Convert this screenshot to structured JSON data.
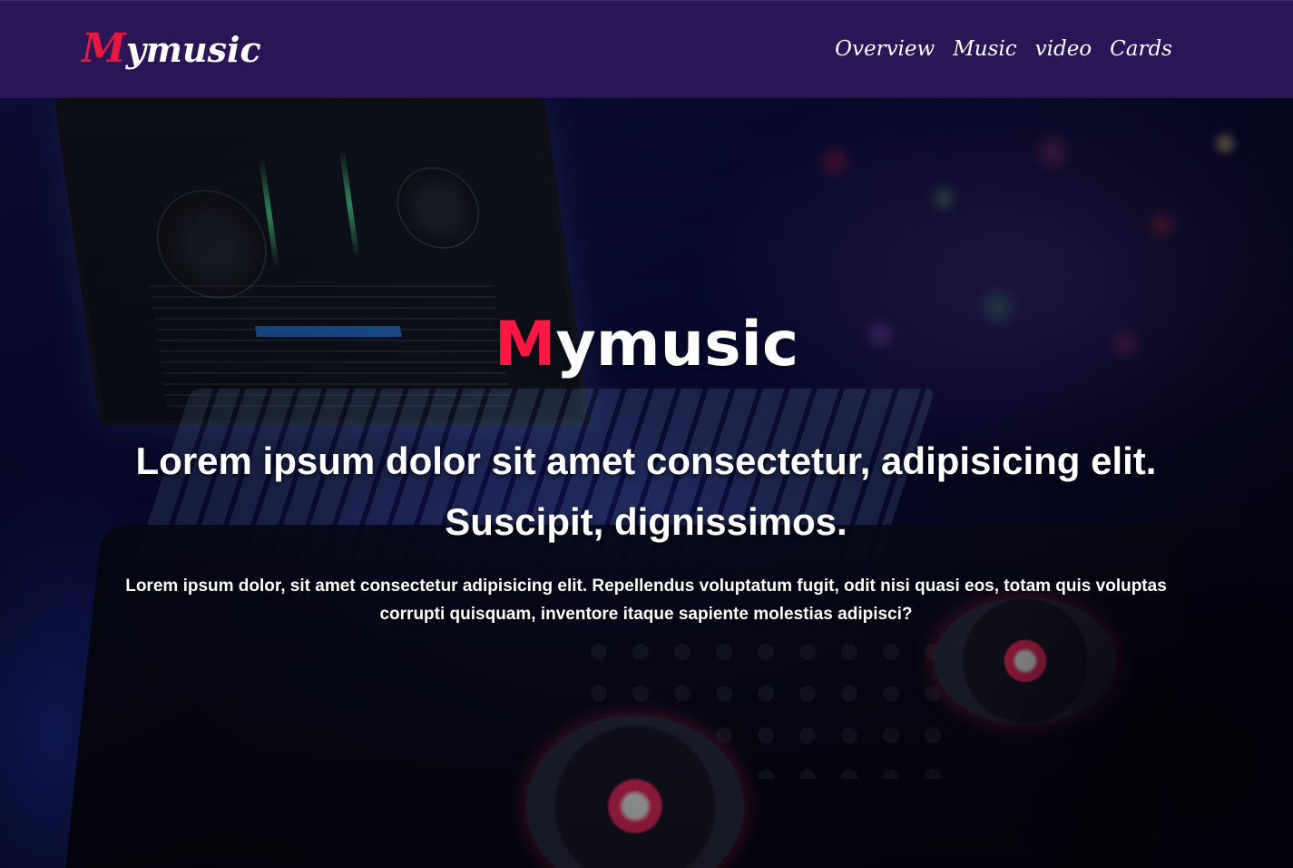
{
  "navbar": {
    "brand_first": "M",
    "brand_rest": "ymusic",
    "links": [
      "Overview",
      "Music",
      "video",
      "Cards"
    ]
  },
  "hero": {
    "title_first": "M",
    "title_rest": "ymusic",
    "heading": "Lorem ipsum dolor sit amet consectetur, adipisicing elit. Suscipit, dignissimos.",
    "paragraph": "Lorem ipsum dolor, sit amet consectetur adipisicing elit. Repellendus voluptatum fugit, odit nisi quasi eos, totam quis voluptas corrupti quisquam, inventore itaque sapiente molestias adipisci?"
  },
  "colors": {
    "navbar_bg": "#2a1557",
    "accent": "#e8173f",
    "text": "#ffffff"
  }
}
